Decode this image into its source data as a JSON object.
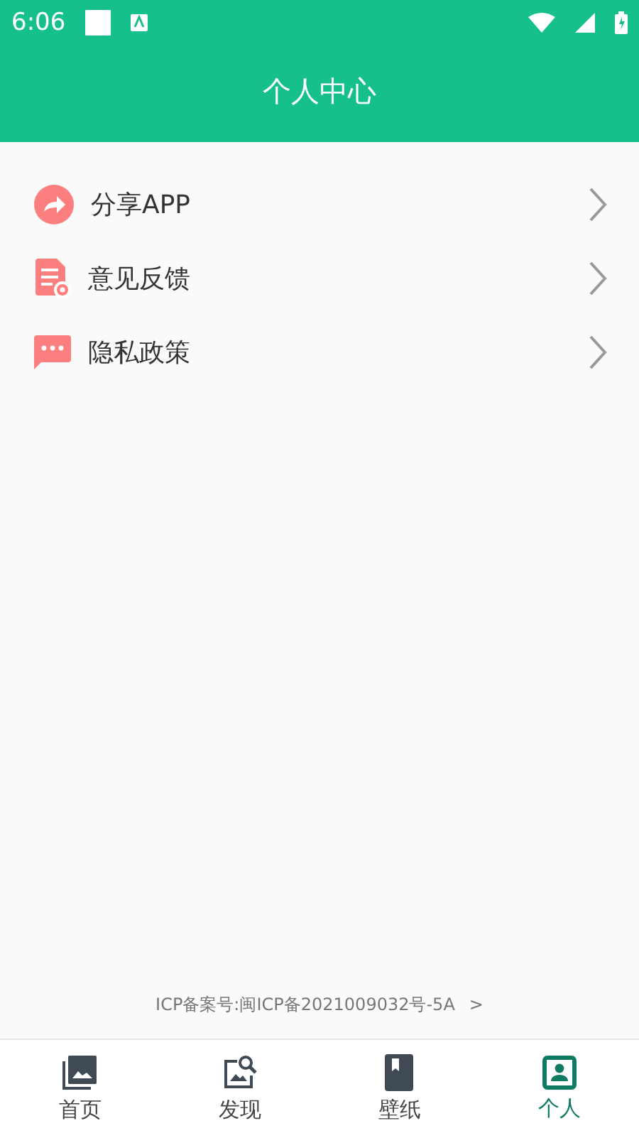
{
  "status_bar": {
    "time": "6:06"
  },
  "header": {
    "title": "个人中心"
  },
  "menu": [
    {
      "label": "分享APP",
      "kind": "share"
    },
    {
      "label": "意见反馈",
      "kind": "feedback"
    },
    {
      "label": "隐私政策",
      "kind": "privacy"
    }
  ],
  "footer": {
    "icp": "ICP备案号:闽ICP备2021009032号-5A",
    "arrow": ">"
  },
  "tabs": [
    {
      "label": "首页",
      "kind": "home",
      "selected": false
    },
    {
      "label": "发现",
      "kind": "discover",
      "selected": false
    },
    {
      "label": "壁纸",
      "kind": "wallpaper",
      "selected": false
    },
    {
      "label": "个人",
      "kind": "profile",
      "selected": true
    }
  ]
}
